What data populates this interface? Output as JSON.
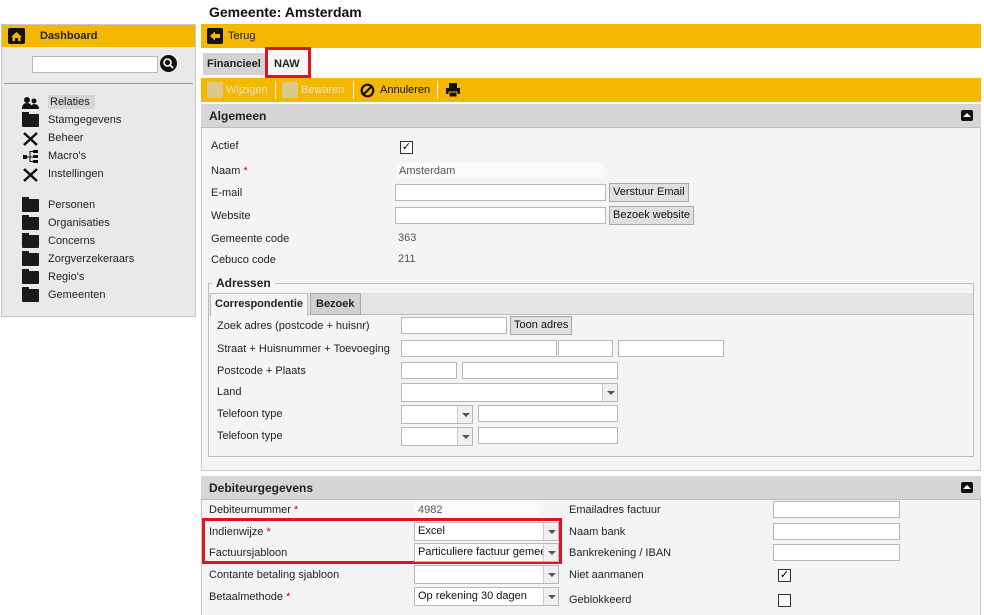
{
  "page_title": "Gemeente: Amsterdam",
  "sidebar": {
    "dashboard_label": "Dashboard",
    "search_placeholder": "",
    "group1": [
      "Relaties",
      "Stamgegevens",
      "Beheer",
      "Macro's",
      "Instellingen"
    ],
    "group2": [
      "Personen",
      "Organisaties",
      "Concerns",
      "Zorgverzekeraars",
      "Regio's",
      "Gemeenten"
    ]
  },
  "back_label": "Terug",
  "tabs": [
    "Financieel",
    "NAW"
  ],
  "toolbar": {
    "edit": "Wijzigen",
    "save": "Bewaren",
    "cancel": "Annuleren"
  },
  "algemeen": {
    "title": "Algemeen",
    "actief_label": "Actief",
    "actief_checked": "✓",
    "naam_label": "Naam",
    "naam_value": "Amsterdam",
    "email_label": "E-mail",
    "email_button": "Verstuur Email",
    "website_label": "Website",
    "website_button": "Bezoek website",
    "gemeente_code_label": "Gemeente code",
    "gemeente_code_value": "363",
    "cebuco_code_label": "Cebuco code",
    "cebuco_code_value": "211"
  },
  "adressen": {
    "title": "Adressen",
    "tabs": [
      "Correspondentie",
      "Bezoek"
    ],
    "zoek_label": "Zoek adres (postcode + huisnr)",
    "zoek_button": "Toon adres",
    "straat_label": "Straat + Huisnummer + Toevoeging",
    "postcode_label": "Postcode + Plaats",
    "land_label": "Land",
    "telefoon1_label": "Telefoon type",
    "telefoon2_label": "Telefoon type"
  },
  "debiteur": {
    "title": "Debiteurgegevens",
    "debiteurnummer_label": "Debiteurnummer",
    "debiteurnummer_value": "4982",
    "indienwijze_label": "Indienwijze",
    "indienwijze_value": "Excel",
    "factuursjabloon_label": "Factuursjabloon",
    "factuursjabloon_value": "Particuliere factuur gemeente",
    "contante_label": "Contante betaling sjabloon",
    "contante_value": "",
    "betaalmethode_label": "Betaalmethode",
    "betaalmethode_value": "Op rekening 30 dagen",
    "emailadres_factuur_label": "Emailadres factuur",
    "naam_bank_label": "Naam bank",
    "bankrekening_label": "Bankrekening / IBAN",
    "niet_aanmanen_label": "Niet aanmanen",
    "niet_aanmanen_checked": "✓",
    "geblokkeerd_label": "Geblokkeerd",
    "geblokkeerd_checked": ""
  },
  "colors": {
    "accent": "#f5b800",
    "highlight": "#e0141e"
  }
}
